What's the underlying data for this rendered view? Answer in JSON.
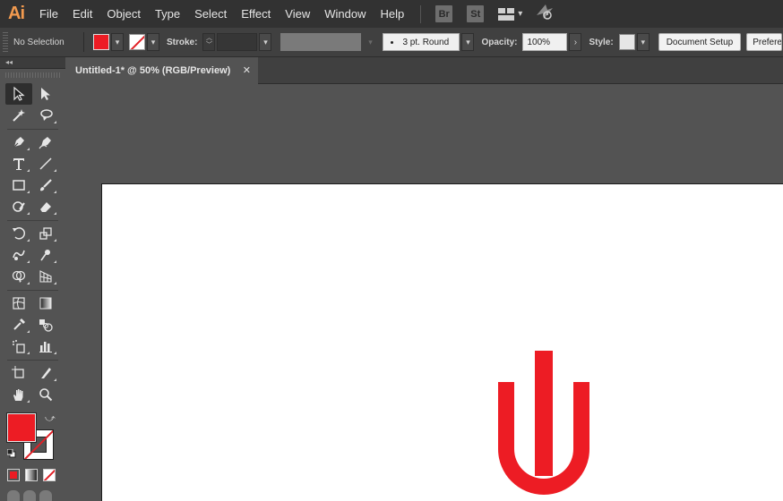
{
  "app": {
    "logo": "Ai",
    "menu": [
      "File",
      "Edit",
      "Object",
      "Type",
      "Select",
      "Effect",
      "View",
      "Window",
      "Help"
    ],
    "bridge_label": "Br",
    "stock_label": "St"
  },
  "control_bar": {
    "selection_status": "No Selection",
    "fill_color": "#ed1c24",
    "stroke_color": "none",
    "stroke_label": "Stroke:",
    "stroke_weight": "",
    "brush_label": "3 pt. Round",
    "opacity_label": "Opacity:",
    "opacity_value": "100%",
    "style_label": "Style:",
    "document_setup_label": "Document Setup",
    "preferences_label": "Prefere"
  },
  "tools": {
    "collapse_label": "◂◂",
    "fill_color": "#ed1c24",
    "stroke_color": "none",
    "icons": [
      [
        "selection-tool",
        "direct-selection-tool"
      ],
      [
        "magic-wand-tool",
        "lasso-tool"
      ],
      [
        "pen-tool",
        "curvature-tool"
      ],
      [
        "type-tool",
        "line-segment-tool"
      ],
      [
        "rectangle-tool",
        "paintbrush-tool"
      ],
      [
        "shaper-tool",
        "eraser-tool"
      ],
      [
        "rotate-tool",
        "scale-tool"
      ],
      [
        "warp-tool",
        "puppet-warp-tool"
      ],
      [
        "shape-builder-tool",
        "perspective-grid-tool"
      ],
      [
        "mesh-tool",
        "gradient-tool"
      ],
      [
        "eyedropper-tool",
        "blend-tool"
      ],
      [
        "symbol-sprayer-tool",
        "column-graph-tool"
      ],
      [
        "artboard-tool",
        "slice-tool"
      ],
      [
        "hand-tool",
        "zoom-tool"
      ]
    ]
  },
  "document": {
    "tab_title": "Untitled-1* @ 50% (RGB/Preview)",
    "close_glyph": "✕",
    "zoom_level": "50%",
    "color_mode": "RGB/Preview",
    "artwork_color": "#ed1c24"
  }
}
